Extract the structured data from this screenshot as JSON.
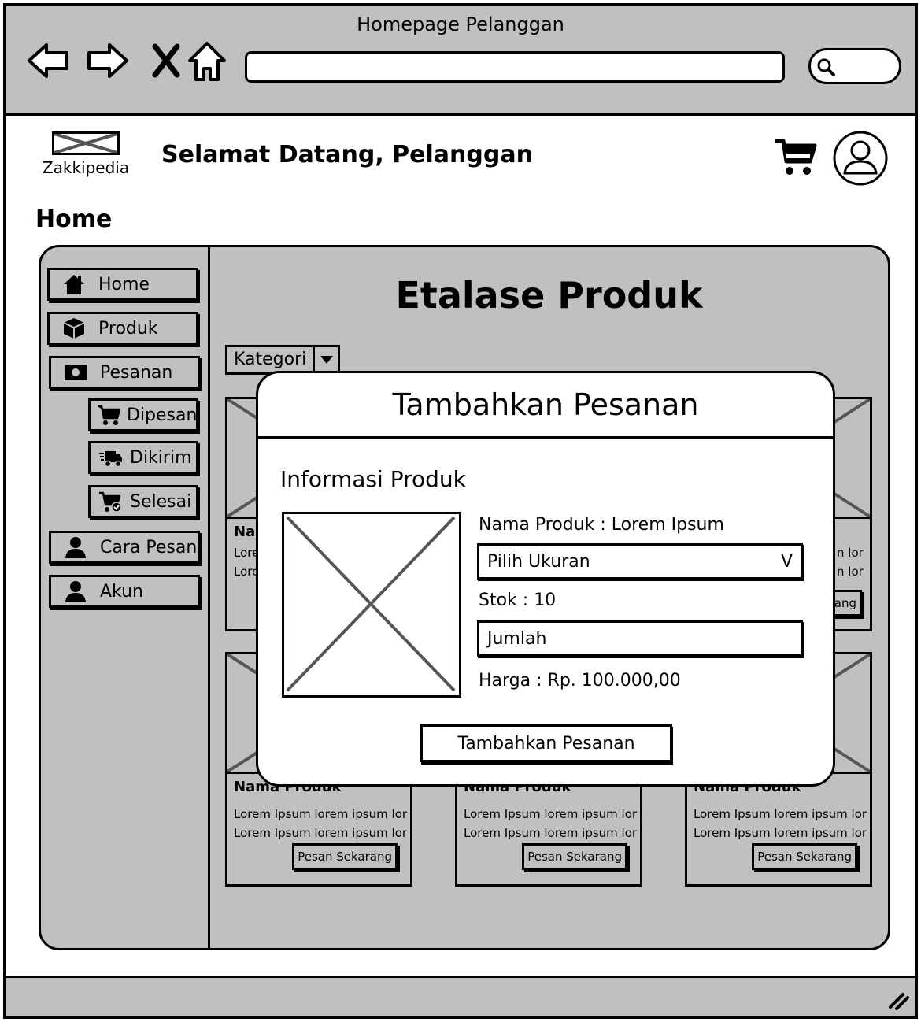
{
  "window": {
    "title": "Homepage Pelanggan"
  },
  "header": {
    "logo_text": "Zakkipedia",
    "welcome": "Selamat Datang, Pelanggan"
  },
  "page": {
    "heading": "Home"
  },
  "sidebar": {
    "items": [
      {
        "label": "Home",
        "icon": "home-icon"
      },
      {
        "label": "Produk",
        "icon": "box-icon"
      },
      {
        "label": "Pesanan",
        "icon": "money-icon"
      },
      {
        "label": "Dipesan",
        "icon": "cart-icon"
      },
      {
        "label": "Dikirim",
        "icon": "truck-icon"
      },
      {
        "label": "Selesai",
        "icon": "cart-check-icon"
      },
      {
        "label": "Cara Pesan",
        "icon": "user-icon"
      },
      {
        "label": "Akun",
        "icon": "user-icon"
      }
    ]
  },
  "main": {
    "title": "Etalase Produk",
    "filter_label": "Kategori",
    "cards": [
      {
        "name": "Na",
        "desc1": "Lore",
        "desc2": "Lore",
        "button": ""
      },
      {
        "name": "",
        "desc1": "n lor",
        "desc2": "n lor",
        "button": "ang"
      },
      {
        "name": "Nama Produk",
        "desc1": "Lorem Ipsum lorem ipsum lor",
        "desc2": "Lorem Ipsum lorem ipsum lor",
        "button": "Pesan Sekarang"
      },
      {
        "name": "Nama Produk",
        "desc1": "Lorem Ipsum lorem ipsum lor",
        "desc2": "Lorem Ipsum lorem ipsum lor",
        "button": "Pesan Sekarang"
      },
      {
        "name": "Nama Produk",
        "desc1": "Lorem Ipsum lorem ipsum lor",
        "desc2": "Lorem Ipsum lorem ipsum lor",
        "button": "Pesan Sekarang"
      }
    ]
  },
  "modal": {
    "title": "Tambahkan Pesanan",
    "section_label": "Informasi Produk",
    "product_name": "Nama Produk : Lorem Ipsum",
    "size_select": "Pilih Ukuran",
    "size_caret": "V",
    "stock": "Stok : 10",
    "qty_placeholder": "Jumlah",
    "price": "Harga : Rp. 100.000,00",
    "submit_label": "Tambahkan Pesanan"
  },
  "colors": {
    "chrome": "#c0c0c0",
    "panel": "#c0c0c0",
    "placeholder_x": "#555555"
  }
}
